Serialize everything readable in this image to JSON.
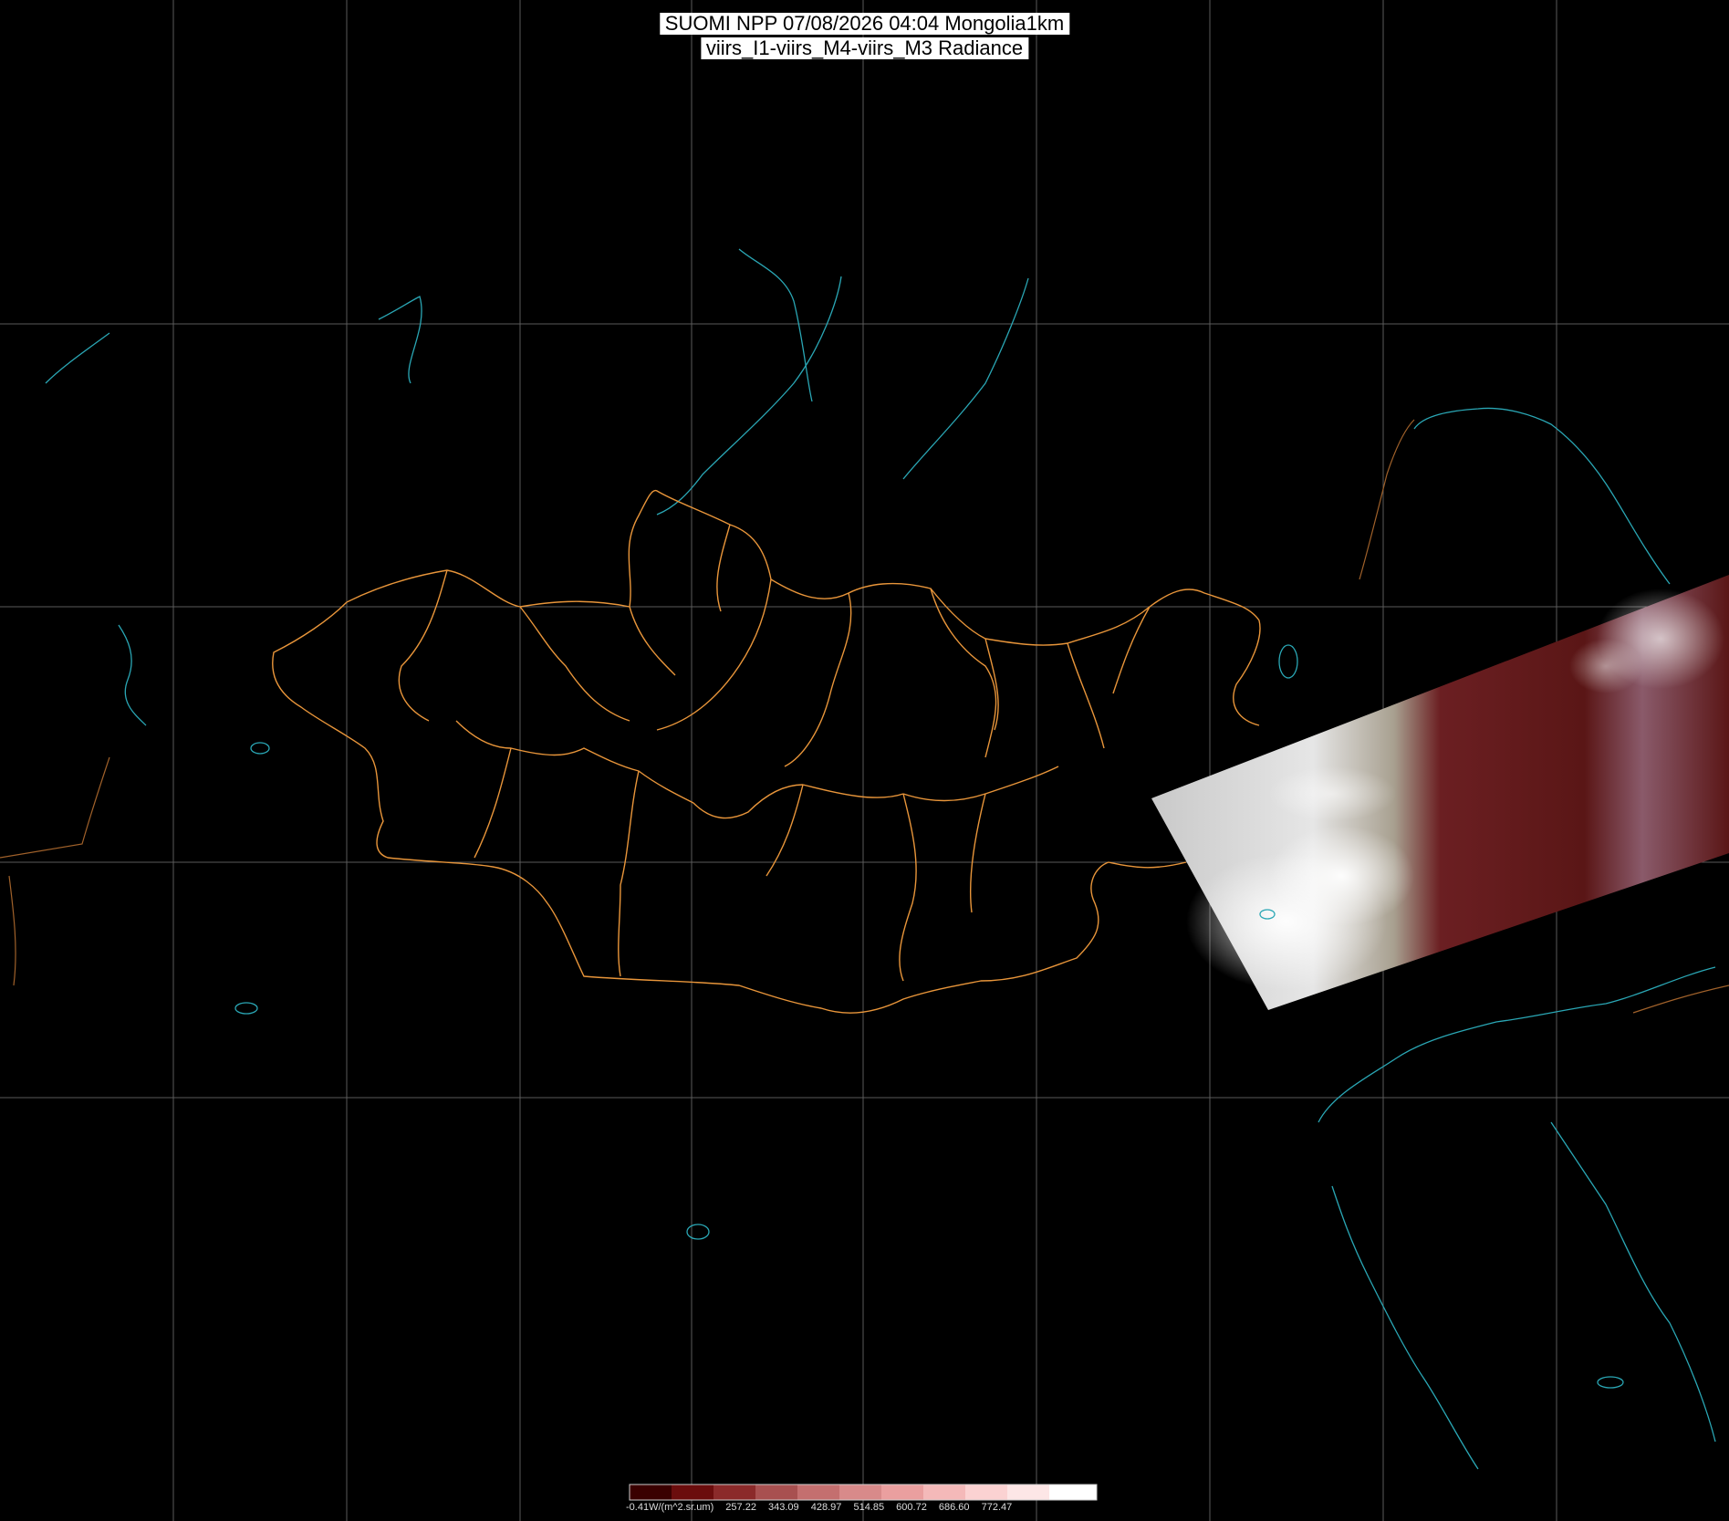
{
  "header": {
    "title_line1": "SUOMI NPP 07/08/2026 04:04 Mongolia1km",
    "title_line2": "viirs_I1-viirs_M4-viirs_M3 Radiance"
  },
  "legend": {
    "labels": [
      "-0.41W/(m^2.sr.um)",
      "257.22",
      "343.09",
      "428.97",
      "514.85",
      "600.72",
      "686.60",
      "772.47"
    ],
    "colors": [
      "#3a0000",
      "#6b0d0d",
      "#8b2a2a",
      "#a85050",
      "#c46f6f",
      "#d88a8a",
      "#ea9f9f",
      "#f4b9b9",
      "#fbd2d2",
      "#fde6e6",
      "#ffffff"
    ]
  },
  "map": {
    "region": "Mongolia",
    "colors": {
      "background": "#000000",
      "grid": "#5a5a5a",
      "admin_borders": "#e8953a",
      "coastlines": "#2aa7b5",
      "country_borders": "#a0612a",
      "swath_forest": "#5a1616",
      "swath_cloud": "#ffffff"
    }
  }
}
